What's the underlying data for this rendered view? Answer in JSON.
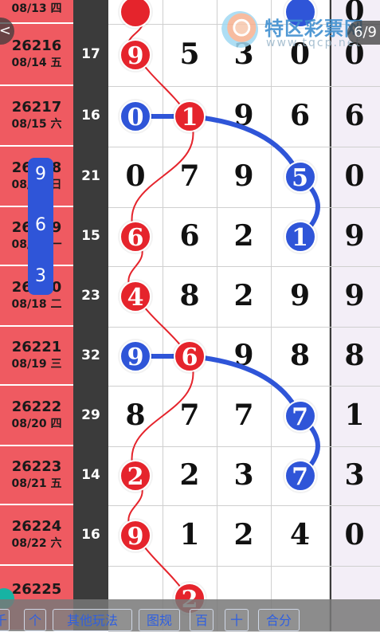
{
  "issues": [
    {
      "issue": "",
      "date": "08/13 四"
    },
    {
      "issue": "26216",
      "date": "08/14 五"
    },
    {
      "issue": "26217",
      "date": "08/15 六"
    },
    {
      "issue": "26218",
      "date": "08/16 日"
    },
    {
      "issue": "26219",
      "date": "08/17 一"
    },
    {
      "issue": "26220",
      "date": "08/18 二"
    },
    {
      "issue": "26221",
      "date": "08/19 三"
    },
    {
      "issue": "26222",
      "date": "08/20 四"
    },
    {
      "issue": "26223",
      "date": "08/21 五"
    },
    {
      "issue": "26224",
      "date": "08/22 六"
    },
    {
      "issue": "26225",
      "date": ""
    }
  ],
  "rows": [
    {
      "sum": "",
      "d": [
        "",
        "",
        "",
        "",
        "0"
      ]
    },
    {
      "sum": "17",
      "d": [
        "9",
        "5",
        "3",
        "0",
        "0"
      ]
    },
    {
      "sum": "16",
      "d": [
        "0",
        "1",
        "9",
        "6",
        "6"
      ]
    },
    {
      "sum": "21",
      "d": [
        "0",
        "7",
        "9",
        "5",
        "0"
      ]
    },
    {
      "sum": "15",
      "d": [
        "6",
        "6",
        "2",
        "1",
        "9"
      ]
    },
    {
      "sum": "23",
      "d": [
        "4",
        "8",
        "2",
        "9",
        "9"
      ]
    },
    {
      "sum": "32",
      "d": [
        "9",
        "6",
        "9",
        "8",
        "8"
      ]
    },
    {
      "sum": "29",
      "d": [
        "8",
        "7",
        "7",
        "7",
        "1"
      ]
    },
    {
      "sum": "14",
      "d": [
        "2",
        "2",
        "3",
        "7",
        "3"
      ]
    },
    {
      "sum": "16",
      "d": [
        "9",
        "1",
        "2",
        "4",
        "0"
      ]
    },
    {
      "sum": "",
      "d": [
        "",
        "2",
        "",
        "",
        ""
      ]
    }
  ],
  "floating_selector": [
    "9",
    "6",
    "3"
  ],
  "logo": {
    "title": "特区彩票网",
    "url": "www.tqcp.net"
  },
  "page_indicator": "6/9",
  "back_label": "<",
  "toolbar": [
    "千",
    "个",
    "其他玩法",
    "图规",
    "百",
    "十",
    "合分"
  ],
  "colors": {
    "red": "#e5242c",
    "blue": "#2f55d8",
    "issue_bg": "#ef5a61",
    "sum_bg": "#3b3b3b"
  }
}
